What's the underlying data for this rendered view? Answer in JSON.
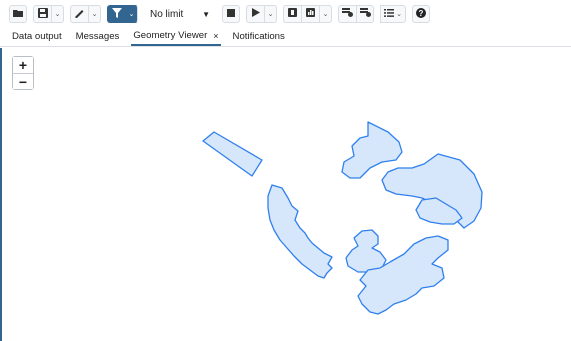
{
  "toolbar": {
    "limit_label": "No limit",
    "icons": [
      "folder-icon",
      "save-icon",
      "edit-icon",
      "filter-icon",
      "stop-icon",
      "play-icon",
      "explain-icon",
      "explain-analyze-icon",
      "commit-icon",
      "rollback-icon",
      "macros-icon",
      "help-icon"
    ],
    "filter_color": "#326690"
  },
  "tabs": [
    {
      "label": "Data output"
    },
    {
      "label": "Messages"
    },
    {
      "label": "Geometry Viewer",
      "close": "×",
      "active": true
    },
    {
      "label": "Notifications"
    }
  ],
  "viewer": {
    "zoom_in": "+",
    "zoom_out": "−",
    "shape_fill": "#d6e6fb",
    "shape_stroke": "#2f80ed",
    "geometries": [
      "polygon",
      "polygon",
      "polygon",
      "polygon",
      "polygon",
      "polygon",
      "polygon"
    ]
  }
}
